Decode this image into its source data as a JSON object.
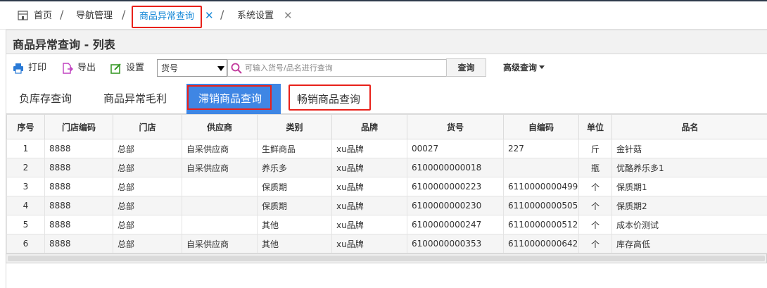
{
  "breadcrumb": {
    "home": "首页",
    "nav": "导航管理",
    "active": "商品异常查询",
    "settings": "系统设置"
  },
  "page_title": "商品异常查询 - 列表",
  "toolbar": {
    "print": "打印",
    "export": "导出",
    "settings": "设置",
    "field_select": "货号",
    "search_placeholder": "可输入货号/品名进行查询",
    "query": "查询",
    "advanced": "高级查询"
  },
  "subtabs": [
    "负库存查询",
    "商品异常毛利",
    "滞销商品查询",
    "畅销商品查询"
  ],
  "table": {
    "columns": [
      "序号",
      "门店编码",
      "门店",
      "供应商",
      "类别",
      "品牌",
      "货号",
      "自编码",
      "单位",
      "品名"
    ],
    "rows": [
      [
        "1",
        "8888",
        "总部",
        "自采供应商",
        "生鲜商品",
        "xu品牌",
        "00027",
        "227",
        "斤",
        "金针菇"
      ],
      [
        "2",
        "8888",
        "总部",
        "自采供应商",
        "养乐多",
        "xu品牌",
        "6100000000018",
        "",
        "瓶",
        "优酪养乐多1"
      ],
      [
        "3",
        "8888",
        "总部",
        "",
        "保质期",
        "xu品牌",
        "6100000000223",
        "6110000000499",
        "个",
        "保质期1"
      ],
      [
        "4",
        "8888",
        "总部",
        "",
        "保质期",
        "xu品牌",
        "6100000000230",
        "6110000000505",
        "个",
        "保质期2"
      ],
      [
        "5",
        "8888",
        "总部",
        "",
        "其他",
        "xu品牌",
        "6100000000247",
        "6110000000512",
        "个",
        "成本价测试"
      ],
      [
        "6",
        "8888",
        "总部",
        "自采供应商",
        "其他",
        "xu品牌",
        "6100000000353",
        "6110000000642",
        "个",
        "库存高低"
      ]
    ]
  },
  "colors": {
    "accent": "#3f86e4",
    "highlight_border": "#e8211a",
    "link_blue": "#1a8ad8"
  }
}
